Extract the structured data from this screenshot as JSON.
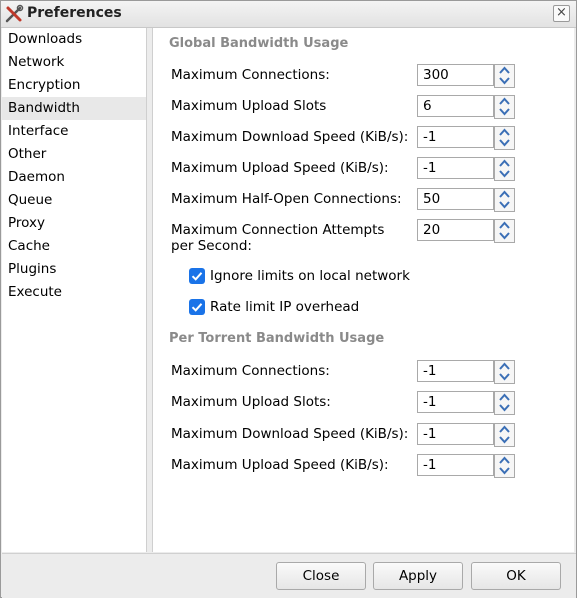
{
  "window": {
    "title": "Preferences",
    "close_symbol": "×"
  },
  "sidebar": {
    "items": [
      {
        "label": "Downloads"
      },
      {
        "label": "Network"
      },
      {
        "label": "Encryption"
      },
      {
        "label": "Bandwidth",
        "active": true
      },
      {
        "label": "Interface"
      },
      {
        "label": "Other"
      },
      {
        "label": "Daemon"
      },
      {
        "label": "Queue"
      },
      {
        "label": "Proxy"
      },
      {
        "label": "Cache"
      },
      {
        "label": "Plugins"
      },
      {
        "label": "Execute"
      }
    ]
  },
  "global": {
    "title": "Global Bandwidth Usage",
    "max_connections": {
      "label": "Maximum Connections:",
      "value": "300"
    },
    "max_upload_slots": {
      "label": "Maximum Upload Slots",
      "value": "6"
    },
    "max_download_speed": {
      "label": "Maximum Download Speed (KiB/s):",
      "value": "-1"
    },
    "max_upload_speed": {
      "label": "Maximum Upload Speed (KiB/s):",
      "value": "-1"
    },
    "max_half_open": {
      "label": "Maximum Half-Open Connections:",
      "value": "50"
    },
    "max_conn_attempts": {
      "label": "Maximum Connection Attempts per Second:",
      "value": "20"
    },
    "ignore_local": {
      "label": "Ignore limits on local network",
      "checked": true
    },
    "rate_limit_ip": {
      "label": "Rate limit IP overhead",
      "checked": true
    }
  },
  "per_torrent": {
    "title": "Per Torrent Bandwidth Usage",
    "max_connections": {
      "label": "Maximum Connections:",
      "value": "-1"
    },
    "max_upload_slots": {
      "label": "Maximum Upload Slots:",
      "value": "-1"
    },
    "max_download_speed": {
      "label": "Maximum Download Speed (KiB/s):",
      "value": "-1"
    },
    "max_upload_speed": {
      "label": "Maximum Upload Speed (KiB/s):",
      "value": "-1"
    }
  },
  "footer": {
    "close_label": "Close",
    "apply_label": "Apply",
    "ok_label": "OK"
  },
  "colors": {
    "checkbox": "#1a73e8",
    "spin_arrow": "#3b6fb6"
  }
}
